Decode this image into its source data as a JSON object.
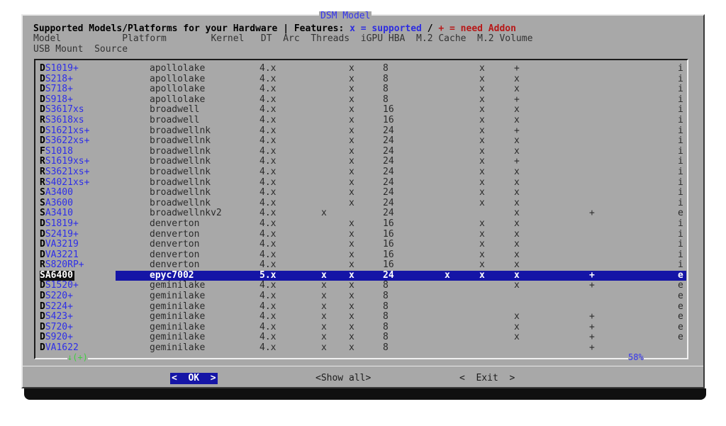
{
  "dialog_title": "DSM Model",
  "header": {
    "line1_prefix": "Supported Models/Platforms for your Hardware | Features: ",
    "line1_supported": "x = supported",
    "line1_mid": " / ",
    "line1_addon": "+ = need Addon",
    "line2": "Model           Platform        Kernel   DT  Arc  Threads  iGPU HBA  M.2 Cache  M.2 Volume",
    "line3": "USB Mount  Source"
  },
  "rows": [
    {
      "model_first": "D",
      "model_rest": "S1019+",
      "platform": "apollolake",
      "kernel": "4.x",
      "dt": "",
      "arc": "x",
      "threads": "8",
      "igpu": "",
      "hba": "x",
      "m2cache": "+",
      "m2volume": "",
      "source": "i"
    },
    {
      "model_first": "D",
      "model_rest": "S218+",
      "platform": "apollolake",
      "kernel": "4.x",
      "dt": "",
      "arc": "x",
      "threads": "8",
      "igpu": "",
      "hba": "x",
      "m2cache": "x",
      "m2volume": "",
      "source": "i"
    },
    {
      "model_first": "D",
      "model_rest": "S718+",
      "platform": "apollolake",
      "kernel": "4.x",
      "dt": "",
      "arc": "x",
      "threads": "8",
      "igpu": "",
      "hba": "x",
      "m2cache": "x",
      "m2volume": "",
      "source": "i"
    },
    {
      "model_first": "D",
      "model_rest": "S918+",
      "platform": "apollolake",
      "kernel": "4.x",
      "dt": "",
      "arc": "x",
      "threads": "8",
      "igpu": "",
      "hba": "x",
      "m2cache": "+",
      "m2volume": "",
      "source": "i"
    },
    {
      "model_first": "D",
      "model_rest": "S3617xs",
      "platform": "broadwell",
      "kernel": "4.x",
      "dt": "",
      "arc": "x",
      "threads": "16",
      "igpu": "",
      "hba": "x",
      "m2cache": "x",
      "m2volume": "",
      "source": "i"
    },
    {
      "model_first": "R",
      "model_rest": "S3618xs",
      "platform": "broadwell",
      "kernel": "4.x",
      "dt": "",
      "arc": "x",
      "threads": "16",
      "igpu": "",
      "hba": "x",
      "m2cache": "x",
      "m2volume": "",
      "source": "i"
    },
    {
      "model_first": "D",
      "model_rest": "S1621xs+",
      "platform": "broadwellnk",
      "kernel": "4.x",
      "dt": "",
      "arc": "x",
      "threads": "24",
      "igpu": "",
      "hba": "x",
      "m2cache": "+",
      "m2volume": "",
      "source": "i"
    },
    {
      "model_first": "D",
      "model_rest": "S3622xs+",
      "platform": "broadwellnk",
      "kernel": "4.x",
      "dt": "",
      "arc": "x",
      "threads": "24",
      "igpu": "",
      "hba": "x",
      "m2cache": "x",
      "m2volume": "",
      "source": "i"
    },
    {
      "model_first": "F",
      "model_rest": "S1018",
      "platform": "broadwellnk",
      "kernel": "4.x",
      "dt": "",
      "arc": "x",
      "threads": "24",
      "igpu": "",
      "hba": "x",
      "m2cache": "x",
      "m2volume": "",
      "source": "i"
    },
    {
      "model_first": "R",
      "model_rest": "S1619xs+",
      "platform": "broadwellnk",
      "kernel": "4.x",
      "dt": "",
      "arc": "x",
      "threads": "24",
      "igpu": "",
      "hba": "x",
      "m2cache": "+",
      "m2volume": "",
      "source": "i"
    },
    {
      "model_first": "R",
      "model_rest": "S3621xs+",
      "platform": "broadwellnk",
      "kernel": "4.x",
      "dt": "",
      "arc": "x",
      "threads": "24",
      "igpu": "",
      "hba": "x",
      "m2cache": "x",
      "m2volume": "",
      "source": "i"
    },
    {
      "model_first": "R",
      "model_rest": "S4021xs+",
      "platform": "broadwellnk",
      "kernel": "4.x",
      "dt": "",
      "arc": "x",
      "threads": "24",
      "igpu": "",
      "hba": "x",
      "m2cache": "x",
      "m2volume": "",
      "source": "i"
    },
    {
      "model_first": "S",
      "model_rest": "A3400",
      "platform": "broadwellnk",
      "kernel": "4.x",
      "dt": "",
      "arc": "x",
      "threads": "24",
      "igpu": "",
      "hba": "x",
      "m2cache": "x",
      "m2volume": "",
      "source": "i"
    },
    {
      "model_first": "S",
      "model_rest": "A3600",
      "platform": "broadwellnk",
      "kernel": "4.x",
      "dt": "",
      "arc": "x",
      "threads": "24",
      "igpu": "",
      "hba": "x",
      "m2cache": "x",
      "m2volume": "",
      "source": "i"
    },
    {
      "model_first": "S",
      "model_rest": "A3410",
      "platform": "broadwellnkv2",
      "kernel": "4.x",
      "dt": "x",
      "arc": "",
      "threads": "24",
      "igpu": "",
      "hba": "",
      "m2cache": "x",
      "m2volume": "+",
      "source": "e"
    },
    {
      "model_first": "D",
      "model_rest": "S1819+",
      "platform": "denverton",
      "kernel": "4.x",
      "dt": "",
      "arc": "x",
      "threads": "16",
      "igpu": "",
      "hba": "x",
      "m2cache": "x",
      "m2volume": "",
      "source": "i"
    },
    {
      "model_first": "D",
      "model_rest": "S2419+",
      "platform": "denverton",
      "kernel": "4.x",
      "dt": "",
      "arc": "x",
      "threads": "16",
      "igpu": "",
      "hba": "x",
      "m2cache": "x",
      "m2volume": "",
      "source": "i"
    },
    {
      "model_first": "D",
      "model_rest": "VA3219",
      "platform": "denverton",
      "kernel": "4.x",
      "dt": "",
      "arc": "x",
      "threads": "16",
      "igpu": "",
      "hba": "x",
      "m2cache": "x",
      "m2volume": "",
      "source": "i"
    },
    {
      "model_first": "D",
      "model_rest": "VA3221",
      "platform": "denverton",
      "kernel": "4.x",
      "dt": "",
      "arc": "x",
      "threads": "16",
      "igpu": "",
      "hba": "x",
      "m2cache": "x",
      "m2volume": "",
      "source": "i"
    },
    {
      "model_first": "R",
      "model_rest": "S820RP+",
      "platform": "denverton",
      "kernel": "4.x",
      "dt": "",
      "arc": "x",
      "threads": "16",
      "igpu": "",
      "hba": "x",
      "m2cache": "x",
      "m2volume": "",
      "source": "i"
    },
    {
      "model_first": "S",
      "model_rest": "A6400",
      "platform": "epyc7002",
      "kernel": "5.x",
      "dt": "x",
      "arc": "x",
      "threads": "24",
      "igpu": "x",
      "hba": "x",
      "m2cache": "x",
      "m2volume": "+",
      "source": "e",
      "selected": true
    },
    {
      "model_first": "D",
      "model_rest": "S1520+",
      "platform": "geminilake",
      "kernel": "4.x",
      "dt": "x",
      "arc": "x",
      "threads": "8",
      "igpu": "",
      "hba": "",
      "m2cache": "x",
      "m2volume": "+",
      "source": "e"
    },
    {
      "model_first": "D",
      "model_rest": "S220+",
      "platform": "geminilake",
      "kernel": "4.x",
      "dt": "x",
      "arc": "x",
      "threads": "8",
      "igpu": "",
      "hba": "",
      "m2cache": "",
      "m2volume": "",
      "source": "e"
    },
    {
      "model_first": "D",
      "model_rest": "S224+",
      "platform": "geminilake",
      "kernel": "4.x",
      "dt": "x",
      "arc": "x",
      "threads": "8",
      "igpu": "",
      "hba": "",
      "m2cache": "",
      "m2volume": "",
      "source": "e"
    },
    {
      "model_first": "D",
      "model_rest": "S423+",
      "platform": "geminilake",
      "kernel": "4.x",
      "dt": "x",
      "arc": "x",
      "threads": "8",
      "igpu": "",
      "hba": "",
      "m2cache": "x",
      "m2volume": "+",
      "source": "e"
    },
    {
      "model_first": "D",
      "model_rest": "S720+",
      "platform": "geminilake",
      "kernel": "4.x",
      "dt": "x",
      "arc": "x",
      "threads": "8",
      "igpu": "",
      "hba": "",
      "m2cache": "x",
      "m2volume": "+",
      "source": "e"
    },
    {
      "model_first": "D",
      "model_rest": "S920+",
      "platform": "geminilake",
      "kernel": "4.x",
      "dt": "x",
      "arc": "x",
      "threads": "8",
      "igpu": "",
      "hba": "",
      "m2cache": "x",
      "m2volume": "+",
      "source": "e"
    },
    {
      "model_first": "D",
      "model_rest": "VA1622",
      "platform": "geminilake",
      "kernel": "4.x",
      "dt": "x",
      "arc": "x",
      "threads": "8",
      "igpu": "",
      "hba": "",
      "m2cache": "",
      "m2volume": "+",
      "source": ""
    }
  ],
  "scroll": {
    "up_indicator": "↓(+)",
    "percent": "58%"
  },
  "buttons": {
    "ok": "<  OK  >",
    "show_all": "<Show all>",
    "exit": "<  Exit  >"
  },
  "colors": {
    "dialog_bg": "#a8a8a8",
    "highlight": "#1515a6",
    "model_text": "#2e2ee8",
    "addon": "#b81818"
  }
}
